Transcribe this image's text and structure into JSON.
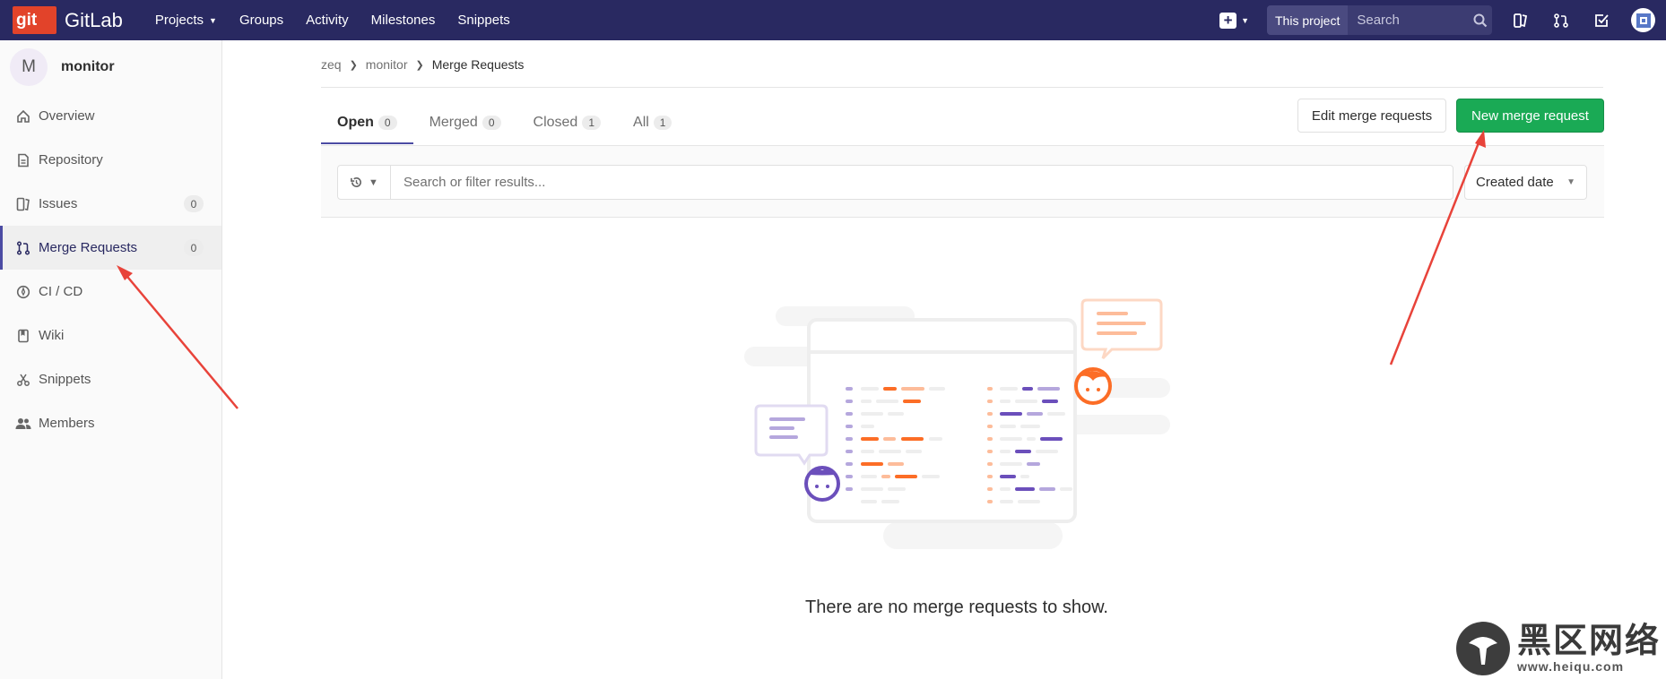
{
  "navbar": {
    "logo_badge": "git",
    "logo_text": "GitLab",
    "links": [
      "Projects",
      "Groups",
      "Activity",
      "Milestones",
      "Snippets"
    ],
    "search_scope": "This project",
    "search_placeholder": "Search"
  },
  "sidebar": {
    "project_initial": "M",
    "project_name": "monitor",
    "items": [
      {
        "label": "Overview",
        "icon": "home-icon"
      },
      {
        "label": "Repository",
        "icon": "doc-icon"
      },
      {
        "label": "Issues",
        "icon": "issues-icon",
        "count": "0"
      },
      {
        "label": "Merge Requests",
        "icon": "merge-request-icon",
        "count": "0",
        "active": true
      },
      {
        "label": "CI / CD",
        "icon": "rocket-icon"
      },
      {
        "label": "Wiki",
        "icon": "book-icon"
      },
      {
        "label": "Snippets",
        "icon": "scissors-icon"
      },
      {
        "label": "Members",
        "icon": "users-icon"
      }
    ]
  },
  "breadcrumb": [
    "zeq",
    "monitor",
    "Merge Requests"
  ],
  "tabs": [
    {
      "label": "Open",
      "count": "0",
      "active": true
    },
    {
      "label": "Merged",
      "count": "0"
    },
    {
      "label": "Closed",
      "count": "1"
    },
    {
      "label": "All",
      "count": "1"
    }
  ],
  "buttons": {
    "edit": "Edit merge requests",
    "new": "New merge request"
  },
  "filter": {
    "placeholder": "Search or filter results...",
    "sort": "Created date"
  },
  "empty_state": "There are no merge requests to show.",
  "watermark": {
    "title": "黑区网络",
    "url": "www.heiqu.com"
  },
  "colors": {
    "navbar": "#292961",
    "new_button": "#1aaa55",
    "annotation": "#e8433a"
  }
}
